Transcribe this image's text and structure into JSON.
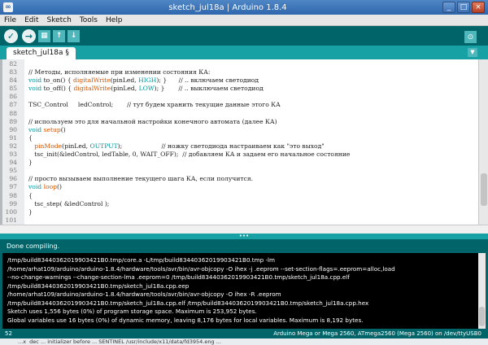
{
  "window": {
    "title": "sketch_jul18a | Arduino 1.8.4",
    "minimize_label": "_",
    "maximize_label": "□",
    "close_label": "×"
  },
  "menu": [
    "File",
    "Edit",
    "Sketch",
    "Tools",
    "Help"
  ],
  "toolbar": {
    "verify": "✓",
    "upload": "→",
    "new": "▦",
    "open": "↑",
    "save": "↓",
    "serial_monitor": "⊙"
  },
  "tab": {
    "name": "sketch_jul18a §",
    "menu": "▼"
  },
  "editor_lines": [
    {
      "n": "82",
      "t": ""
    },
    {
      "n": "83",
      "t": "// Методы, исполняемые при изменении состояния КА:"
    },
    {
      "n": "84",
      "t": "void to_on() { digitalWrite(pinLed, HIGH); }      // .. включаем светодиод"
    },
    {
      "n": "85",
      "t": "void to_off() { digitalWrite(pinLed, LOW); }       // .. выключаем светодиод"
    },
    {
      "n": "86",
      "t": ""
    },
    {
      "n": "87",
      "t": "TSC_Control     ledControl;       // тут будем хранить текущие данные этого КА"
    },
    {
      "n": "88",
      "t": ""
    },
    {
      "n": "89",
      "t": "// используем это для начальной настройки конечного автомата (далее КА)"
    },
    {
      "n": "90",
      "t": "void setup()"
    },
    {
      "n": "91",
      "t": "{"
    },
    {
      "n": "92",
      "t": "   pinMode(pinLed, OUTPUT);                    // ножку светодиода настраиваем как \"это выход\""
    },
    {
      "n": "93",
      "t": "   tsc_init(&ledControl, ledTable, 0, WAIT_OFF);  // добавляем КА и задаем его начальное состояние"
    },
    {
      "n": "94",
      "t": "}"
    },
    {
      "n": "95",
      "t": ""
    },
    {
      "n": "96",
      "t": "// просто вызываем выполнение текущего шага КА, если получится."
    },
    {
      "n": "97",
      "t": "void loop()"
    },
    {
      "n": "98",
      "t": "{"
    },
    {
      "n": "99",
      "t": "   tsc_step( &ledControl );"
    },
    {
      "n": "100",
      "t": "}"
    },
    {
      "n": "101",
      "t": ""
    }
  ],
  "divider_handle": "•••",
  "status": "Done compiling.",
  "console_lines": [
    "/tmp/build83440362019903421B0.tmp/core.a -L/tmp/build83440362019903421B0.tmp -lm",
    "/home/arhat109/arduino/arduino-1.8.4/hardware/tools/avr/bin/avr-objcopy -O ihex -j .eeprom --set-section-flags=.eeprom=alloc,load",
    "--no-change-warnings --change-section-lma .eeprom=0 /tmp/build83440362019903421B0.tmp/sketch_jul18a.cpp.elf",
    "/tmp/build83440362019903421B0.tmp/sketch_jul18a.cpp.eep",
    "/home/arhat109/arduino/arduino-1.8.4/hardware/tools/avr/bin/avr-objcopy -O ihex -R .eeprom",
    "/tmp/build83440362019903421B0.tmp/sketch_jul18a.cpp.elf /tmp/build83440362019903421B0.tmp/sketch_jul18a.cpp.hex",
    "Sketch uses 1,556 bytes (0%) of program storage space. Maximum is 253,952 bytes.",
    "Global variables use 16 bytes (0%) of dynamic memory, leaving 8,176 bytes for local variables. Maximum is 8,192 bytes."
  ],
  "footer": {
    "line": "52",
    "board": "Arduino Mega or Mega 2560, ATmega2560 (Mega 2560) on /dev/ttyUSB0"
  },
  "background_text": "...x  dec ... initializer before ... SENTINEL  /usr/include/x11/data/fd3954.eng ..."
}
